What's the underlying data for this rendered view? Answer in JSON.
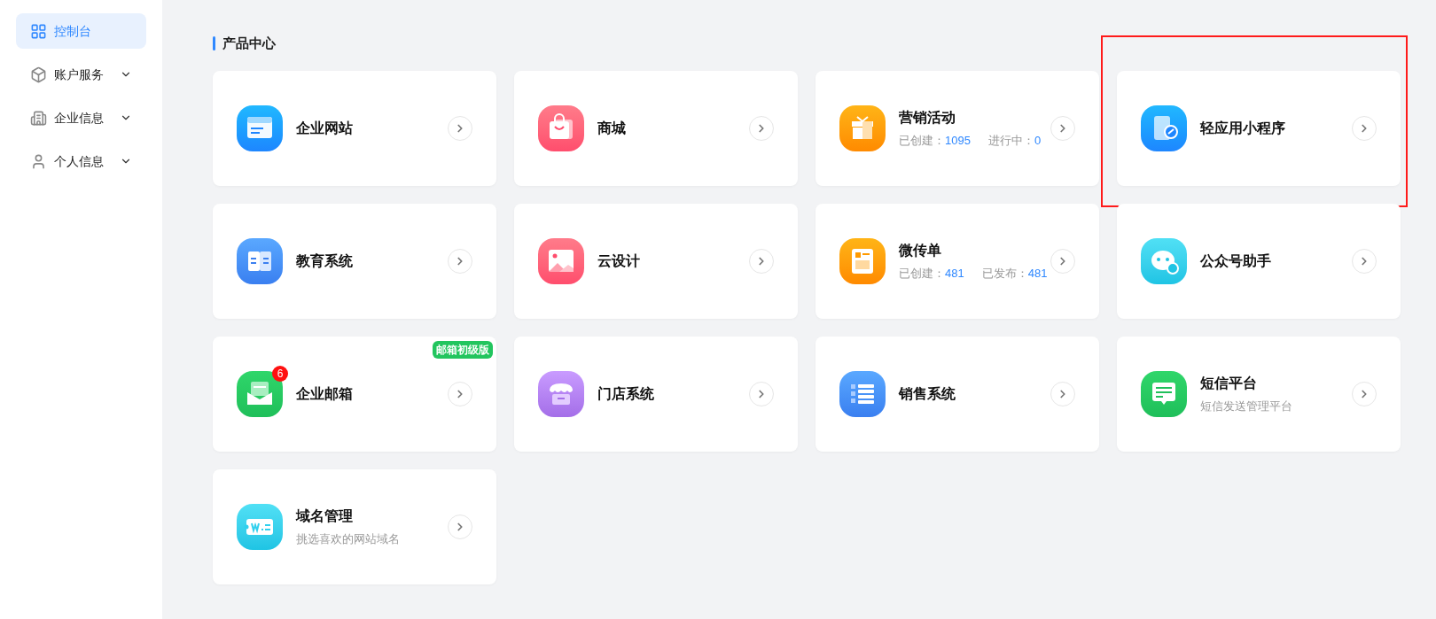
{
  "sidebar": {
    "items": [
      {
        "label": "控制台",
        "kind": "link",
        "selected": true
      },
      {
        "label": "账户服务",
        "kind": "group",
        "selected": false,
        "expanded": false
      },
      {
        "label": "企业信息",
        "kind": "group",
        "selected": false,
        "expanded": false
      },
      {
        "label": "个人信息",
        "kind": "group",
        "selected": false,
        "expanded": false
      }
    ]
  },
  "section": {
    "title": "产品中心"
  },
  "products": [
    {
      "name": "企业网站",
      "highlighted": false
    },
    {
      "name": "商城",
      "highlighted": false
    },
    {
      "name": "营销活动",
      "highlighted": false,
      "stats": [
        {
          "label": "已创建：",
          "value": "1095"
        },
        {
          "label": "进行中：",
          "value": "0"
        }
      ]
    },
    {
      "name": "轻应用小程序",
      "highlighted": true
    },
    {
      "name": "教育系统",
      "highlighted": false
    },
    {
      "name": "云设计",
      "highlighted": false
    },
    {
      "name": "微传单",
      "highlighted": false,
      "stats": [
        {
          "label": "已创建：",
          "value": "481"
        },
        {
          "label": "已发布：",
          "value": "481"
        }
      ]
    },
    {
      "name": "公众号助手",
      "highlighted": false
    },
    {
      "name": "企业邮箱",
      "highlighted": false,
      "badge": "邮箱初级版",
      "count": "6"
    },
    {
      "name": "门店系统",
      "highlighted": false
    },
    {
      "name": "销售系统",
      "highlighted": false
    },
    {
      "name": "短信平台",
      "highlighted": false,
      "subtitle": "短信发送管理平台"
    },
    {
      "name": "域名管理",
      "highlighted": false,
      "subtitle": "挑选喜欢的网站域名"
    }
  ]
}
